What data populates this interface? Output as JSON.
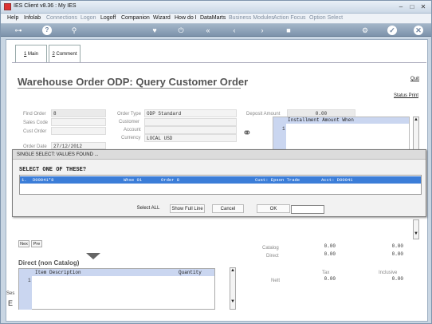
{
  "window": {
    "title": "IES Client v8.36 : My IES",
    "min": "–",
    "max": "□",
    "close": "✕"
  },
  "menu": [
    {
      "label": "Help",
      "enabled": true
    },
    {
      "label": "Infolab",
      "enabled": true
    },
    {
      "label": "Connections",
      "enabled": false
    },
    {
      "label": "Logon",
      "enabled": false
    },
    {
      "label": "Logoff",
      "enabled": true
    },
    {
      "label": "Companion",
      "enabled": true
    },
    {
      "label": "Wizard",
      "enabled": true
    },
    {
      "label": "How do I",
      "enabled": true
    },
    {
      "label": "DataMarts",
      "enabled": true
    },
    {
      "label": "Business Modules",
      "enabled": false
    },
    {
      "label": "Action Focus",
      "enabled": false
    },
    {
      "label": "Option Select",
      "enabled": false
    }
  ],
  "toolbar": {
    "icons": [
      "key-icon",
      "help-icon",
      "search-icon",
      "heart-icon",
      "power-icon",
      "rewind-icon",
      "back-icon",
      "forward-icon",
      "stop-icon",
      "settings-icon",
      "check-icon",
      "close-icon"
    ]
  },
  "tabs": [
    {
      "key": "1",
      "label": "Main"
    },
    {
      "key": "2",
      "label": "Comment"
    }
  ],
  "form": {
    "title": "Warehouse Order ODP: Query Customer Order",
    "quit": "Quit",
    "status_print": "Status Print",
    "find_order_label": "Find Order",
    "find_order_value": "8",
    "sales_code_label": "Sales Code",
    "cust_order_label": "Cust Order",
    "order_date_label": "Order Date",
    "order_date_value": "27/12/2012",
    "order_type_label": "Order Type",
    "order_type_value": "ODP Standard",
    "customer_label": "Customer",
    "account_label": "Account",
    "currency_label": "Currency",
    "currency_value": "LOCAL USD",
    "deposit_label": "Deposit Amount",
    "deposit_value": "0.00",
    "installment_header": "Installment Amount When",
    "installment_row": "1"
  },
  "dialog": {
    "title": "SINGLE SELECT: VALUES FOUND ...",
    "heading": "SELECT ONE OF THESE?",
    "row": {
      "num": "1.",
      "code": "D00041*8",
      "whse": "Whse 01",
      "order": "Order 8",
      "cust": "Cust: Epson Trade",
      "acct": "Acct: D00041"
    },
    "select_all": "Select ALL",
    "show_full_line": "Show Full Line",
    "cancel": "Cancel",
    "ok": "OK"
  },
  "nav": {
    "next": "Nex",
    "prev": "Pre"
  },
  "totals": {
    "catalog_label": "Catalog",
    "catalog_a": "0.00",
    "catalog_b": "0.00",
    "direct_label": "Direct",
    "direct_a": "0.00",
    "direct_b": "0.00",
    "tax_label": "Tax",
    "inclusive_label": "Inclusive",
    "nett_label": "Nett",
    "nett_a": "0.00",
    "nett_b": "0.00"
  },
  "direct": {
    "title": "Direct (non Catalog)",
    "col_desc": "Item Description",
    "col_qty": "Quantity",
    "row": "1"
  },
  "side_clip": {
    "a": "Ses",
    "b": "E"
  }
}
